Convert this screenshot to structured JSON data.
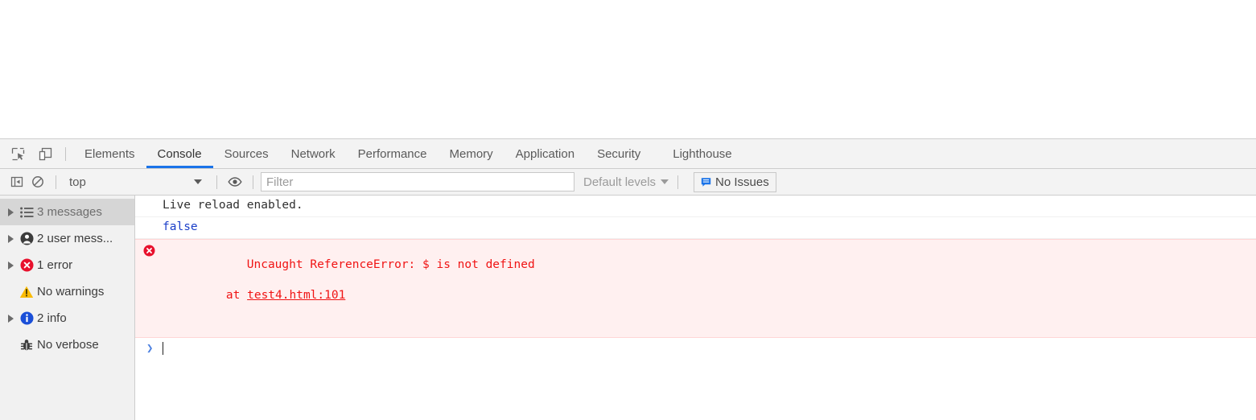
{
  "devtools": {
    "toolbar_icons": [
      {
        "name": "inspect-element-icon",
        "title": "Inspect element"
      },
      {
        "name": "device-toolbar-icon",
        "title": "Toggle device toolbar"
      }
    ],
    "tabs": [
      {
        "label": "Elements",
        "active": false
      },
      {
        "label": "Console",
        "active": true
      },
      {
        "label": "Sources",
        "active": false
      },
      {
        "label": "Network",
        "active": false
      },
      {
        "label": "Performance",
        "active": false
      },
      {
        "label": "Memory",
        "active": false
      },
      {
        "label": "Application",
        "active": false
      },
      {
        "label": "Security",
        "active": false
      },
      {
        "label": "Lighthouse",
        "active": false
      }
    ],
    "active_tab_underline_color": "#1a73e8"
  },
  "console_toolbar": {
    "sidebar_toggle_icon": "show-console-sidebar-icon",
    "clear_icon": "clear-console-icon",
    "context": {
      "value": "top",
      "caret_icon": "chevron-down-icon"
    },
    "eye_icon": "live-expression-eye-icon",
    "filter": {
      "placeholder": "Filter",
      "value": ""
    },
    "levels": {
      "label": "Default levels",
      "caret_icon": "chevron-down-icon"
    },
    "issues": {
      "label": "No Issues",
      "icon": "issues-speech-bubble-icon",
      "icon_color": "#1a73e8"
    }
  },
  "sidebar": {
    "items": [
      {
        "label": "3 messages",
        "icon": "list-messages-icon",
        "expandable": true,
        "selected": true,
        "muted": true
      },
      {
        "label": "2 user mess...",
        "icon": "user-message-icon",
        "expandable": true,
        "selected": false,
        "muted": false
      },
      {
        "label": "1 error",
        "icon": "error-circle-icon",
        "expandable": true,
        "selected": false,
        "muted": false
      },
      {
        "label": "No warnings",
        "icon": "warning-triangle-icon",
        "expandable": false,
        "selected": false,
        "muted": false
      },
      {
        "label": "2 info",
        "icon": "info-circle-icon",
        "expandable": true,
        "selected": false,
        "muted": false
      },
      {
        "label": "No verbose",
        "icon": "bug-verbose-icon",
        "expandable": false,
        "selected": false,
        "muted": false
      }
    ]
  },
  "console_messages": [
    {
      "kind": "log",
      "text": "Live reload enabled."
    },
    {
      "kind": "value",
      "text": "false"
    },
    {
      "kind": "error",
      "icon": "error-circle-icon",
      "text": "Uncaught ReferenceError: $ is not defined",
      "stack_prefix": "    at ",
      "stack_link": "test4.html:101"
    }
  ],
  "prompt": {
    "chevron": "❯"
  },
  "colors": {
    "error_text": "#f01414",
    "error_bg": "#fff0f0",
    "value_text": "#1a3ec8",
    "accent": "#1a73e8",
    "sidebar_bg": "#f1f1f1",
    "toolbar_bg": "#f3f3f3"
  }
}
